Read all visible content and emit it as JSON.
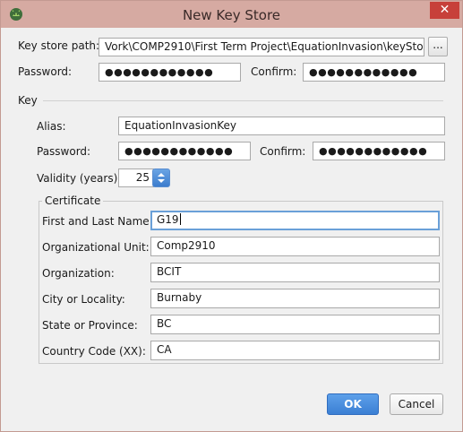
{
  "window": {
    "title": "New Key Store",
    "close_glyph": "✕",
    "icon": "android-studio-icon"
  },
  "keystore": {
    "path_label": "Key store path:",
    "path_value": "Vork\\COMP2910\\First Term Project\\EquationInvasion\\keyStore.jks",
    "browse_label": "...",
    "password_label": "Password:",
    "password_value": "●●●●●●●●●●●●",
    "confirm_label": "Confirm:",
    "confirm_value": "●●●●●●●●●●●●"
  },
  "key": {
    "section_label": "Key",
    "alias_label": "Alias:",
    "alias_value": "EquationInvasionKey",
    "password_label": "Password:",
    "password_value": "●●●●●●●●●●●●",
    "confirm_label": "Confirm:",
    "confirm_value": "●●●●●●●●●●●●",
    "validity_label": "Validity (years):",
    "validity_value": "25"
  },
  "certificate": {
    "group_label": "Certificate",
    "fields": [
      {
        "label": "First and Last Name:",
        "value": "G19"
      },
      {
        "label": "Organizational Unit:",
        "value": "Comp2910"
      },
      {
        "label": "Organization:",
        "value": "BCIT"
      },
      {
        "label": "City or Locality:",
        "value": "Burnaby"
      },
      {
        "label": "State or Province:",
        "value": "BC"
      },
      {
        "label": "Country Code (XX):",
        "value": "CA"
      }
    ]
  },
  "buttons": {
    "ok": "OK",
    "cancel": "Cancel"
  }
}
